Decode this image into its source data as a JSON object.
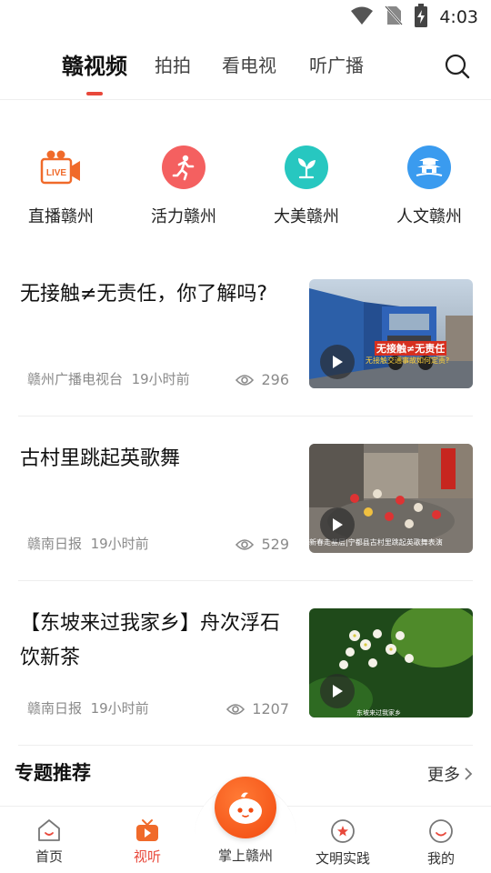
{
  "status_bar": {
    "time": "4:03"
  },
  "top_tabs": {
    "active": "赣视频",
    "items": [
      "赣视频",
      "拍拍",
      "看电视",
      "听广播"
    ]
  },
  "categories": [
    {
      "label": "直播赣州",
      "icon": "live-camera-icon",
      "color": "#f06a2a"
    },
    {
      "label": "活力赣州",
      "icon": "runner-icon",
      "color": "#f46060"
    },
    {
      "label": "大美赣州",
      "icon": "leaf-icon",
      "color": "#27c7c0"
    },
    {
      "label": "人文赣州",
      "icon": "pavilion-icon",
      "color": "#3a9bef"
    }
  ],
  "news": [
    {
      "title": "无接触≠无责任，你了解吗?",
      "source": "赣州广播电视台",
      "time": "19小时前",
      "views": "296",
      "thumb_caption": "无接触≠无责任",
      "thumb_sub": "无接触交通事故如何定责?"
    },
    {
      "title": "古村里跳起英歌舞",
      "source": "赣南日报",
      "time": "19小时前",
      "views": "529",
      "thumb_caption": "新春走基层|宁都县古村里跳起英歌舞表演"
    },
    {
      "title": "【东坡来过我家乡】舟次浮石饮新茶",
      "source": "赣南日报",
      "time": "19小时前",
      "views": "1207",
      "thumb_caption": "东坡来过我家乡"
    }
  ],
  "section": {
    "title": "专题推荐",
    "more": "更多"
  },
  "bottom_nav": {
    "items": [
      {
        "label": "首页",
        "icon": "home-face-icon"
      },
      {
        "label": "视听",
        "icon": "tv-play-icon",
        "active": true
      },
      {
        "label": "掌上赣州",
        "icon": "mascot-icon"
      },
      {
        "label": "文明实践",
        "icon": "star-badge-icon"
      },
      {
        "label": "我的",
        "icon": "profile-face-icon"
      }
    ]
  },
  "colors": {
    "accent": "#e8483b",
    "center_button": "#f24a10"
  }
}
